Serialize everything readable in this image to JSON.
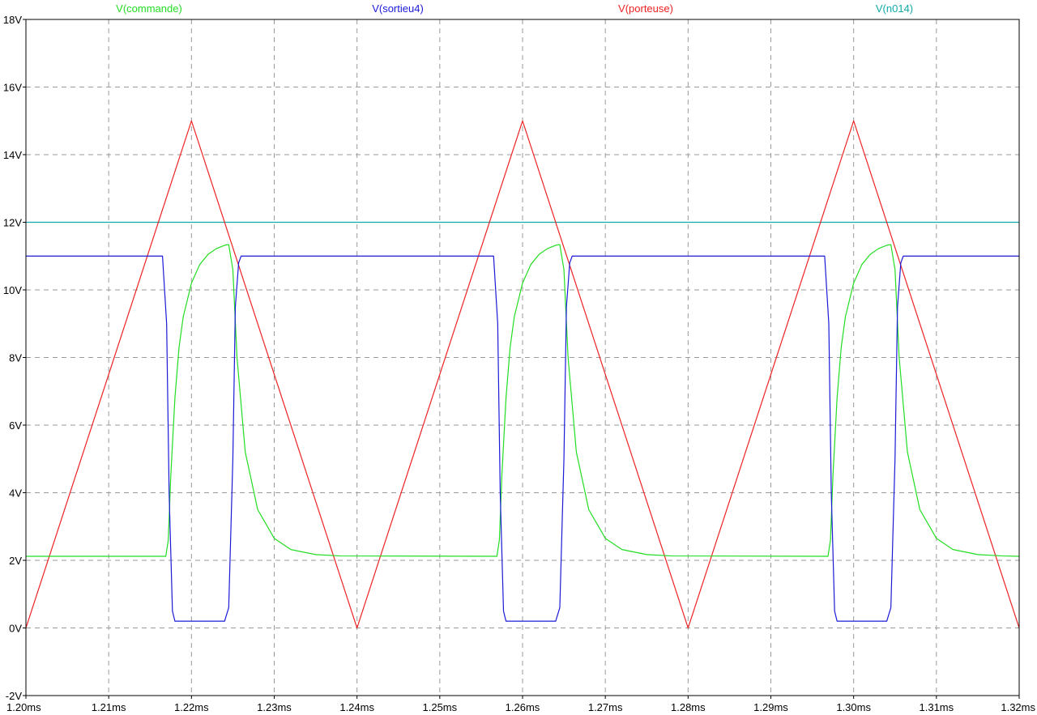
{
  "chart_data": {
    "type": "line",
    "title": "",
    "xlabel": "",
    "ylabel": "",
    "xlim": [
      1.2,
      1.32
    ],
    "ylim": [
      -2,
      18
    ],
    "grid": true,
    "legend_position": "top",
    "x_ticks": [
      1.2,
      1.21,
      1.22,
      1.23,
      1.24,
      1.25,
      1.26,
      1.27,
      1.28,
      1.29,
      1.3,
      1.31,
      1.32
    ],
    "x_tick_labels": [
      "1.20ms",
      "1.21ms",
      "1.22ms",
      "1.23ms",
      "1.24ms",
      "1.25ms",
      "1.26ms",
      "1.27ms",
      "1.28ms",
      "1.29ms",
      "1.30ms",
      "1.31ms",
      "1.32ms"
    ],
    "y_ticks": [
      -2,
      0,
      2,
      4,
      6,
      8,
      10,
      12,
      14,
      16,
      18
    ],
    "y_tick_labels": [
      "-2V",
      "0V",
      "2V",
      "4V",
      "6V",
      "8V",
      "10V",
      "12V",
      "14V",
      "16V",
      "18V"
    ],
    "series": [
      {
        "name": "V(commande)",
        "color": "#22dd22",
        "points": [
          [
            1.2,
            2.12
          ],
          [
            1.2169,
            2.12
          ],
          [
            1.2172,
            2.6
          ],
          [
            1.2175,
            4.5
          ],
          [
            1.218,
            6.8
          ],
          [
            1.2185,
            8.3
          ],
          [
            1.219,
            9.2
          ],
          [
            1.22,
            10.2
          ],
          [
            1.221,
            10.75
          ],
          [
            1.222,
            11.05
          ],
          [
            1.223,
            11.22
          ],
          [
            1.224,
            11.32
          ],
          [
            1.2245,
            11.34
          ],
          [
            1.225,
            10.6
          ],
          [
            1.2255,
            8.0
          ],
          [
            1.2265,
            5.2
          ],
          [
            1.228,
            3.5
          ],
          [
            1.23,
            2.65
          ],
          [
            1.232,
            2.32
          ],
          [
            1.235,
            2.17
          ],
          [
            1.238,
            2.13
          ],
          [
            1.2569,
            2.12
          ],
          [
            1.2572,
            2.6
          ],
          [
            1.2575,
            4.5
          ],
          [
            1.258,
            6.8
          ],
          [
            1.2585,
            8.3
          ],
          [
            1.259,
            9.2
          ],
          [
            1.26,
            10.2
          ],
          [
            1.261,
            10.75
          ],
          [
            1.262,
            11.05
          ],
          [
            1.263,
            11.22
          ],
          [
            1.264,
            11.32
          ],
          [
            1.2645,
            11.34
          ],
          [
            1.265,
            10.6
          ],
          [
            1.2655,
            8.0
          ],
          [
            1.2665,
            5.2
          ],
          [
            1.268,
            3.5
          ],
          [
            1.27,
            2.65
          ],
          [
            1.272,
            2.32
          ],
          [
            1.275,
            2.17
          ],
          [
            1.278,
            2.13
          ],
          [
            1.2969,
            2.12
          ],
          [
            1.2972,
            2.6
          ],
          [
            1.2975,
            4.5
          ],
          [
            1.298,
            6.8
          ],
          [
            1.2985,
            8.3
          ],
          [
            1.299,
            9.2
          ],
          [
            1.3,
            10.2
          ],
          [
            1.301,
            10.75
          ],
          [
            1.302,
            11.05
          ],
          [
            1.303,
            11.22
          ],
          [
            1.304,
            11.32
          ],
          [
            1.3045,
            11.34
          ],
          [
            1.305,
            10.6
          ],
          [
            1.3055,
            8.0
          ],
          [
            1.3065,
            5.2
          ],
          [
            1.308,
            3.5
          ],
          [
            1.31,
            2.65
          ],
          [
            1.312,
            2.32
          ],
          [
            1.315,
            2.17
          ],
          [
            1.318,
            2.13
          ],
          [
            1.32,
            2.12
          ]
        ]
      },
      {
        "name": "V(sortieu4)",
        "color": "#1a1ad8",
        "points": [
          [
            1.2,
            11.0
          ],
          [
            1.2165,
            11.0
          ],
          [
            1.217,
            9.0
          ],
          [
            1.2173,
            4.0
          ],
          [
            1.2177,
            0.5
          ],
          [
            1.218,
            0.2
          ],
          [
            1.224,
            0.2
          ],
          [
            1.2245,
            0.6
          ],
          [
            1.225,
            5.0
          ],
          [
            1.2253,
            9.5
          ],
          [
            1.2257,
            10.8
          ],
          [
            1.226,
            11.0
          ],
          [
            1.2565,
            11.0
          ],
          [
            1.257,
            9.0
          ],
          [
            1.2573,
            4.0
          ],
          [
            1.2577,
            0.5
          ],
          [
            1.258,
            0.2
          ],
          [
            1.264,
            0.2
          ],
          [
            1.2645,
            0.6
          ],
          [
            1.265,
            5.0
          ],
          [
            1.2653,
            9.5
          ],
          [
            1.2657,
            10.8
          ],
          [
            1.266,
            11.0
          ],
          [
            1.2965,
            11.0
          ],
          [
            1.297,
            9.0
          ],
          [
            1.2973,
            4.0
          ],
          [
            1.2977,
            0.5
          ],
          [
            1.298,
            0.2
          ],
          [
            1.304,
            0.2
          ],
          [
            1.3045,
            0.6
          ],
          [
            1.305,
            5.0
          ],
          [
            1.3053,
            9.5
          ],
          [
            1.3057,
            10.8
          ],
          [
            1.306,
            11.0
          ],
          [
            1.32,
            11.0
          ]
        ]
      },
      {
        "name": "V(porteuse)",
        "color": "#ee2222",
        "points": [
          [
            1.2,
            0
          ],
          [
            1.22,
            15
          ],
          [
            1.24,
            0
          ],
          [
            1.26,
            15
          ],
          [
            1.28,
            0
          ],
          [
            1.3,
            15
          ],
          [
            1.32,
            0
          ]
        ]
      },
      {
        "name": "V(n014)",
        "color": "#11aaaa",
        "points": [
          [
            1.2,
            12
          ],
          [
            1.32,
            12
          ]
        ]
      }
    ]
  }
}
